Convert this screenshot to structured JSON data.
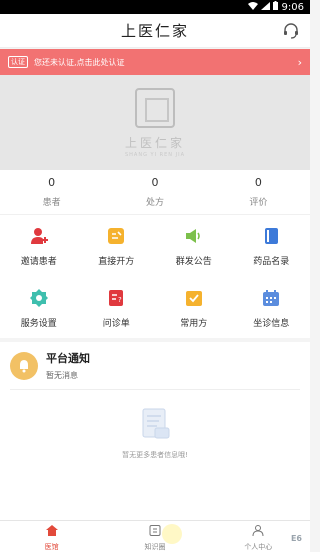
{
  "statusbar": {
    "time": "9:06"
  },
  "header": {
    "title": "上医仁家"
  },
  "banner": {
    "badge": "认证",
    "message": "您还未认证,点击此处认证",
    "arrow": "›"
  },
  "hero": {
    "logo_text": "上医仁家",
    "logo_sub": "SHANG YI REN JIA"
  },
  "stats": [
    {
      "value": "0",
      "label": "患者"
    },
    {
      "value": "0",
      "label": "处方"
    },
    {
      "value": "0",
      "label": "评价"
    }
  ],
  "grid": [
    {
      "label": "邀请患者",
      "icon": "invite-patient-icon",
      "color": "#e0393e"
    },
    {
      "label": "直接开方",
      "icon": "prescribe-icon",
      "color": "#f5b22e"
    },
    {
      "label": "群发公告",
      "icon": "broadcast-icon",
      "color": "#7cc04b"
    },
    {
      "label": "药品名录",
      "icon": "drug-catalog-icon",
      "color": "#3d7ad9"
    },
    {
      "label": "服务设置",
      "icon": "service-settings-icon",
      "color": "#3fbfae"
    },
    {
      "label": "问诊单",
      "icon": "consult-form-icon",
      "color": "#e0393e"
    },
    {
      "label": "常用方",
      "icon": "common-prescription-icon",
      "color": "#f5b22e"
    },
    {
      "label": "坐诊信息",
      "icon": "clinic-calendar-icon",
      "color": "#5b8dde"
    }
  ],
  "notice": {
    "title": "平台通知",
    "subtitle": "暂无消息",
    "empty_text": "暂无更多患者信息哦!"
  },
  "tabbar": [
    {
      "label": "医馆",
      "icon": "home-icon",
      "active": true
    },
    {
      "label": "知识圈",
      "icon": "knowledge-icon",
      "active": false
    },
    {
      "label": "个人中心",
      "icon": "profile-icon",
      "active": false
    }
  ],
  "watermark": "E6"
}
